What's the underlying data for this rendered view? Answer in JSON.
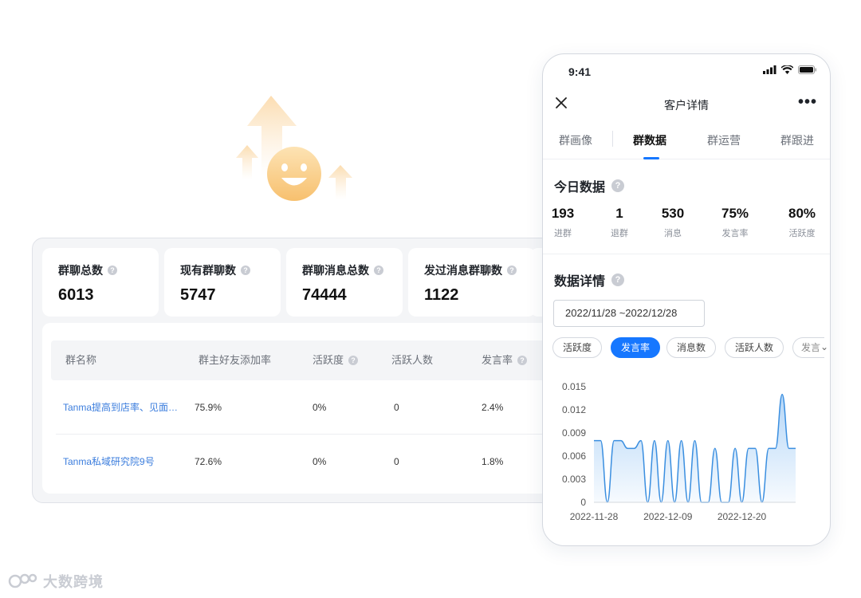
{
  "dashboard": {
    "stats": [
      {
        "label": "群聊总数",
        "value": "6013"
      },
      {
        "label": "现有群聊数",
        "value": "5747"
      },
      {
        "label": "群聊消息总数",
        "value": "74444"
      },
      {
        "label": "发过消息群聊数",
        "value": "1122"
      }
    ],
    "table": {
      "headers": [
        "群名称",
        "群主好友添加率",
        "活跃度",
        "活跃人数",
        "发言率"
      ],
      "rows": [
        [
          "Tanma提高到店率、见面…",
          "75.9%",
          "0%",
          "0",
          "2.4%"
        ],
        [
          "Tanma私域研究院9号",
          "72.6%",
          "0%",
          "0",
          "1.8%"
        ]
      ]
    }
  },
  "phone": {
    "status_time": "9:41",
    "nav_title": "客户详情",
    "more_label": "•••",
    "tabs": [
      "群画像",
      "群数据",
      "群运营",
      "群跟进"
    ],
    "active_tab": "群数据",
    "today_title": "今日数据",
    "kpis": [
      {
        "value": "193",
        "label": "进群"
      },
      {
        "value": "1",
        "label": "退群"
      },
      {
        "value": "530",
        "label": "消息"
      },
      {
        "value": "75%",
        "label": "发言率"
      },
      {
        "value": "80%",
        "label": "活跃度"
      }
    ],
    "detail_title": "数据详情",
    "date_range": "2022/11/28  ~2022/12/28",
    "chips": [
      "活跃度",
      "发言率",
      "消息数",
      "活跃人数",
      "发言"
    ],
    "active_chip": "发言率"
  },
  "chart_data": {
    "type": "area",
    "y_ticks": [
      "0.015",
      "0.012",
      "0.009",
      "0.006",
      "0.003",
      "0"
    ],
    "x_ticks": [
      "2022-11-28",
      "2022-12-09",
      "2022-12-20"
    ],
    "ylim": [
      0,
      0.015
    ],
    "x": [
      "2022-11-28",
      "2022-11-29",
      "2022-11-30",
      "2022-12-01",
      "2022-12-02",
      "2022-12-03",
      "2022-12-04",
      "2022-12-05",
      "2022-12-06",
      "2022-12-07",
      "2022-12-08",
      "2022-12-09",
      "2022-12-10",
      "2022-12-11",
      "2022-12-12",
      "2022-12-13",
      "2022-12-14",
      "2022-12-15",
      "2022-12-16",
      "2022-12-17",
      "2022-12-18",
      "2022-12-19",
      "2022-12-20",
      "2022-12-21",
      "2022-12-22",
      "2022-12-23",
      "2022-12-24",
      "2022-12-25",
      "2022-12-26",
      "2022-12-27",
      "2022-12-28"
    ],
    "values": [
      0.008,
      0.008,
      0,
      0.008,
      0.008,
      0.007,
      0.007,
      0.008,
      0,
      0.008,
      0,
      0.008,
      0,
      0.008,
      0,
      0.008,
      0,
      0,
      0.007,
      0,
      0,
      0.007,
      0,
      0.007,
      0.007,
      0,
      0.007,
      0.007,
      0.014,
      0.007,
      0.007
    ],
    "color": "#3b8fe0"
  },
  "watermark": "大数跨境"
}
